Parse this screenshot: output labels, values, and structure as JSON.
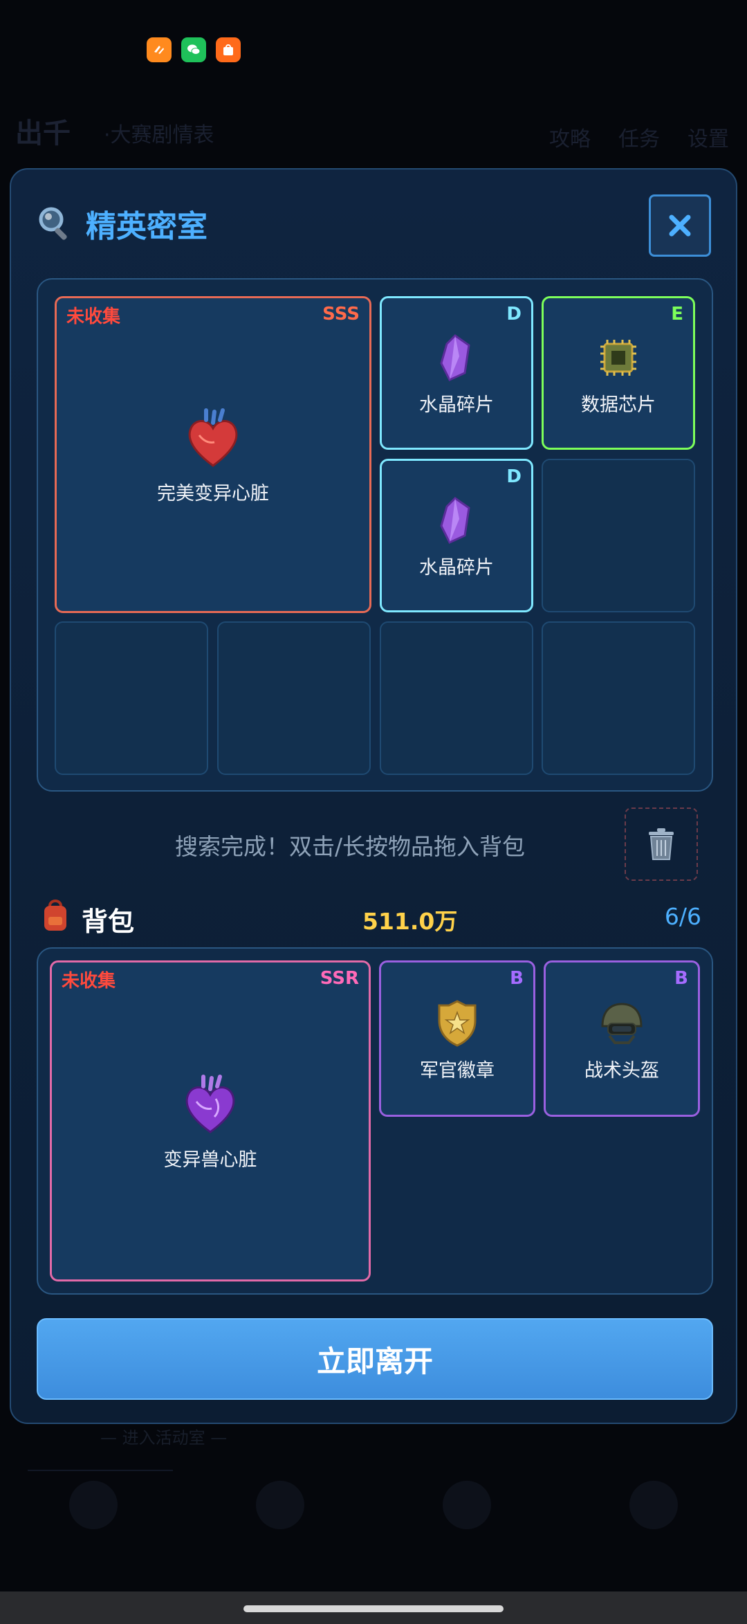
{
  "background_page": {
    "title": "出千",
    "subtitle": "·大赛剧情表",
    "tabs": [
      "攻略",
      "任务",
      "设置"
    ],
    "footer_text": "— 进入活动室 —"
  },
  "modal": {
    "title": "精英密室",
    "close_icon": "close-icon",
    "room_items": [
      {
        "name": "完美变异心脏",
        "rarity": "SSS",
        "rarity_color": "#ff6a4a",
        "border_color": "#e86a55",
        "uncollected": "未收集",
        "icon": "heart-icon"
      },
      {
        "name": "水晶碎片",
        "rarity": "D",
        "rarity_color": "#7fe8ff",
        "border_color": "#7fe8ff",
        "icon": "crystal-icon"
      },
      {
        "name": "数据芯片",
        "rarity": "E",
        "rarity_color": "#7dff5a",
        "border_color": "#7dff5a",
        "icon": "chip-icon"
      },
      {
        "name": "水晶碎片",
        "rarity": "D",
        "rarity_color": "#7fe8ff",
        "border_color": "#7fe8ff",
        "icon": "crystal-icon"
      }
    ],
    "hint": "搜索完成！双击/长按物品拖入背包",
    "trash_icon": "trash-icon",
    "bag": {
      "title": "背包",
      "money": "511.0万",
      "count": "6/6",
      "items": [
        {
          "name": "变异兽心脏",
          "rarity": "SSR",
          "rarity_color": "#ff6ab8",
          "border_color": "#e26aa8",
          "uncollected": "未收集",
          "icon": "purple-heart-icon"
        },
        {
          "name": "军官徽章",
          "rarity": "B",
          "rarity_color": "#a56cff",
          "border_color": "#9a60e0",
          "icon": "badge-icon"
        },
        {
          "name": "战术头盔",
          "rarity": "B",
          "rarity_color": "#a56cff",
          "border_color": "#9a60e0",
          "icon": "helmet-icon"
        }
      ]
    },
    "leave_button": "立即离开"
  },
  "colors": {
    "accent": "#4db0ff",
    "money": "#ffd24a",
    "uncollected": "#ff4a3d"
  }
}
